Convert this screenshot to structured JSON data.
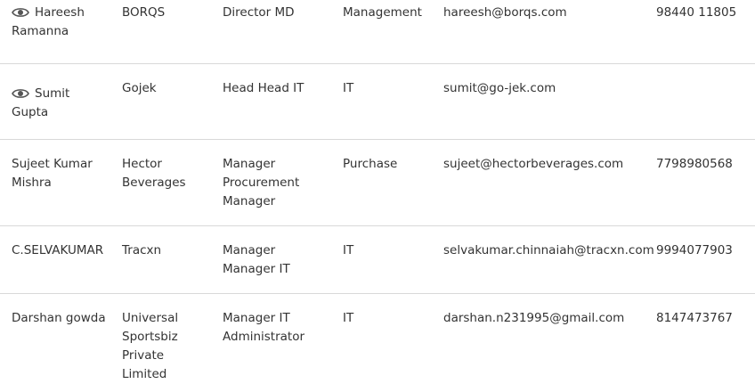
{
  "contacts": [
    {
      "has_view_icon": true,
      "name_lines": [
        "Hareesh",
        "Ramanna"
      ],
      "company_lines": [
        "BORQS"
      ],
      "title_lines": [
        "Director MD"
      ],
      "department": "Management",
      "email": "hareesh@borqs.com",
      "phone": "98440 11805"
    },
    {
      "has_view_icon": true,
      "name_lines": [
        "Sumit",
        "Gupta"
      ],
      "company_lines": [
        "Gojek"
      ],
      "title_lines": [
        "Head Head IT"
      ],
      "department": "IT",
      "email": "sumit@go-jek.com",
      "phone": ""
    },
    {
      "has_view_icon": false,
      "name_lines": [
        "Sujeet Kumar",
        "Mishra"
      ],
      "company_lines": [
        "Hector",
        "Beverages"
      ],
      "title_lines": [
        "Manager",
        "Procurement",
        "Manager"
      ],
      "department": "Purchase",
      "email": "sujeet@hectorbeverages.com",
      "phone": "7798980568"
    },
    {
      "has_view_icon": false,
      "name_lines": [
        "C.SELVAKUMAR"
      ],
      "company_lines": [
        "Tracxn"
      ],
      "title_lines": [
        "Manager",
        "Manager IT"
      ],
      "department": "IT",
      "email": "selvakumar.chinnaiah@tracxn.com",
      "phone": "9994077903"
    },
    {
      "has_view_icon": false,
      "name_lines": [
        "Darshan gowda"
      ],
      "company_lines": [
        "Universal",
        "Sportsbiz",
        "Private",
        "Limited"
      ],
      "title_lines": [
        "Manager IT",
        "Administrator"
      ],
      "department": "IT",
      "email": "darshan.n231995@gmail.com",
      "phone": "8147473767"
    }
  ],
  "icons": {
    "view": "eye-icon"
  },
  "colors": {
    "text": "#333333",
    "icon": "#555555",
    "divider": "#d9d9d9"
  }
}
